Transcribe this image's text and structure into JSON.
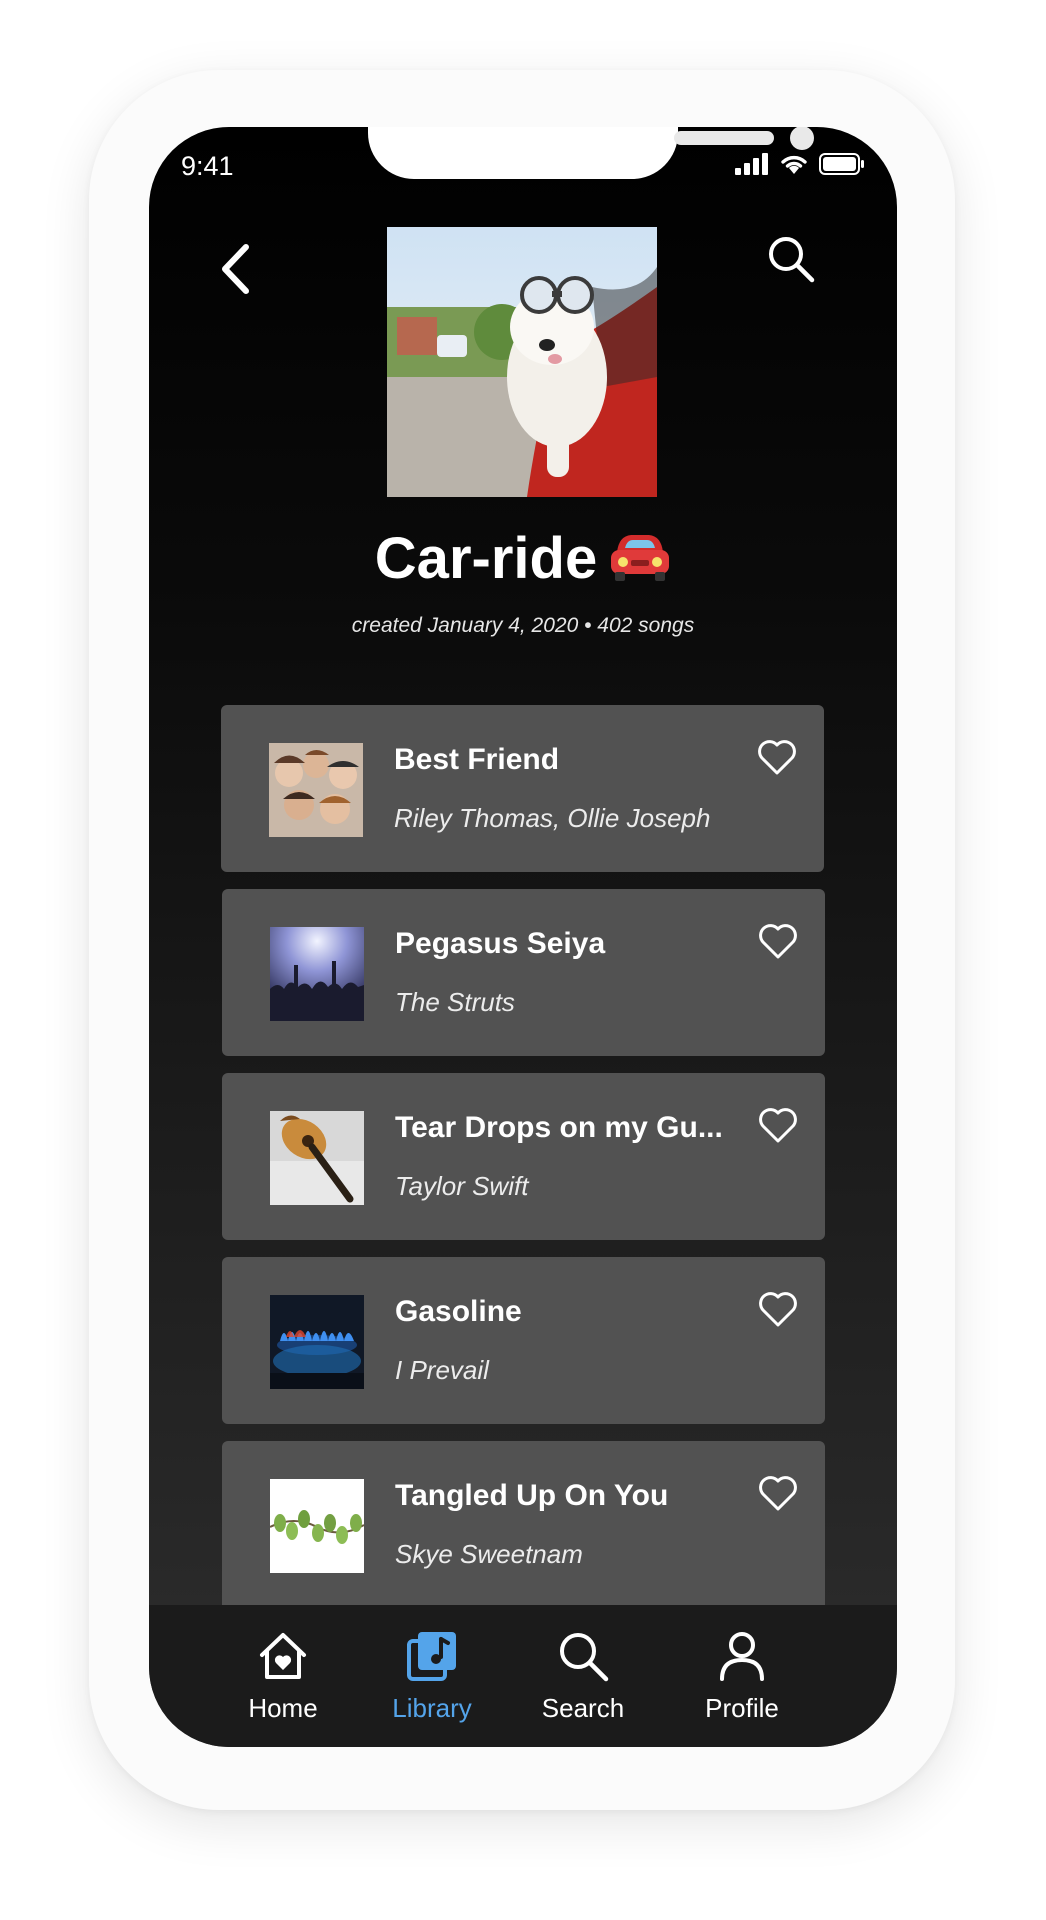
{
  "status_bar": {
    "time": "9:41"
  },
  "header": {
    "back_icon": "chevron-left-icon",
    "search_icon": "search-icon"
  },
  "playlist": {
    "title": "Car-ride",
    "title_emoji": "car-emoji",
    "subtitle": "created January 4, 2020 • 402 songs"
  },
  "songs": [
    {
      "title": "Best Friend",
      "artist": "Riley Thomas, Ollie Joseph"
    },
    {
      "title": "Pegasus Seiya",
      "artist": "The Struts"
    },
    {
      "title": "Tear Drops on my Gu...",
      "artist": "Taylor Swift"
    },
    {
      "title": "Gasoline",
      "artist": "I Prevail"
    },
    {
      "title": "Tangled Up On You",
      "artist": "Skye Sweetnam"
    }
  ],
  "tabbar": {
    "items": [
      {
        "label": "Home",
        "icon": "home-icon"
      },
      {
        "label": "Library",
        "icon": "library-icon",
        "active": true
      },
      {
        "label": "Search",
        "icon": "search-icon"
      },
      {
        "label": "Profile",
        "icon": "profile-icon"
      }
    ]
  },
  "colors": {
    "accent": "#54a4ea",
    "card": "#525252",
    "tabbar": "#1b1b1b"
  }
}
